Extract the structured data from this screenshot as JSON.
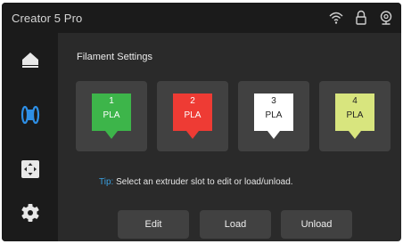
{
  "header": {
    "title": "Creator 5 Pro",
    "icons": [
      "wifi-icon",
      "lock-icon",
      "camera-icon"
    ]
  },
  "sidebar": {
    "items": [
      {
        "name": "home",
        "icon": "home-icon",
        "active": false
      },
      {
        "name": "filament",
        "icon": "filament-spool-icon",
        "active": true
      },
      {
        "name": "move",
        "icon": "move-control-icon",
        "active": false
      },
      {
        "name": "settings",
        "icon": "gear-icon",
        "active": false
      }
    ],
    "active_color": "#2e8fe6",
    "inactive_color": "#e8e8e8"
  },
  "main": {
    "title": "Filament Settings",
    "slots": [
      {
        "number": "1",
        "material": "PLA",
        "color": "#3db54a",
        "text_color": "#ffffff",
        "pointer_color": "#3db54a"
      },
      {
        "number": "2",
        "material": "PLA",
        "color": "#ee3b34",
        "text_color": "#ffffff",
        "pointer_color": "#ee3b34"
      },
      {
        "number": "3",
        "material": "PLA",
        "color": "#ffffff",
        "text_color": "#222222",
        "pointer_color": "#ffffff"
      },
      {
        "number": "4",
        "material": "PLA",
        "color": "#d8e57e",
        "text_color": "#222222",
        "pointer_color": "#d8e57e"
      }
    ],
    "tip_label": "Tip:",
    "tip_text": "Select an extruder slot to edit or load/unload."
  },
  "actions": {
    "edit_label": "Edit",
    "load_label": "Load",
    "unload_label": "Unload"
  }
}
